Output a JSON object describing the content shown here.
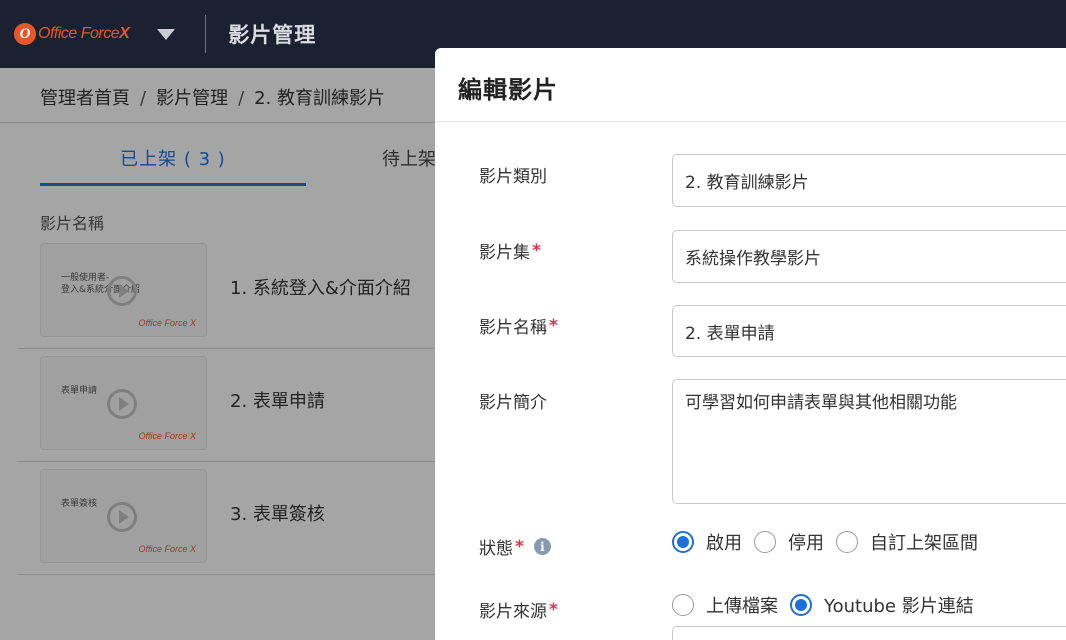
{
  "header": {
    "logo_mark": "O",
    "logo_text": "Office Force",
    "logo_suffix": "X",
    "title": "影片管理"
  },
  "breadcrumb": [
    "管理者首頁",
    "影片管理",
    "2. 教育訓練影片"
  ],
  "tabs": [
    {
      "label": "已上架 ( 3 )"
    },
    {
      "label": "待上架"
    }
  ],
  "list": {
    "column_header": "影片名稱",
    "items": [
      {
        "thumb_text": "一般使用者-\n登入&系統介面介紹",
        "name": "1. 系統登入&介面介紹"
      },
      {
        "thumb_text": "表單申請",
        "name": "2. 表單申請"
      },
      {
        "thumb_text": "表單簽核",
        "name": "3. 表單簽核"
      }
    ]
  },
  "thumb_logo": "Office Force X",
  "modal": {
    "title": "編輯影片",
    "fields": {
      "category": {
        "label": "影片類別",
        "value": "2. 教育訓練影片"
      },
      "collection": {
        "label": "影片集",
        "value": "系統操作教學影片"
      },
      "name": {
        "label": "影片名稱",
        "value": "2. 表單申請"
      },
      "intro": {
        "label": "影片簡介",
        "value": "可學習如何申請表單與其他相關功能"
      },
      "status": {
        "label": "狀態",
        "info_glyph": "i",
        "options": [
          "啟用",
          "停用",
          "自訂上架區間"
        ],
        "selected": "啟用"
      },
      "source": {
        "label": "影片來源",
        "options": [
          "上傳檔案",
          "Youtube 影片連結"
        ],
        "selected": "Youtube 影片連結"
      }
    },
    "required_mark": "*"
  },
  "colors": {
    "topbar": "#1b2130",
    "accent": "#1e6fd9",
    "required": "#e0314b",
    "brand": "#e8572a"
  }
}
